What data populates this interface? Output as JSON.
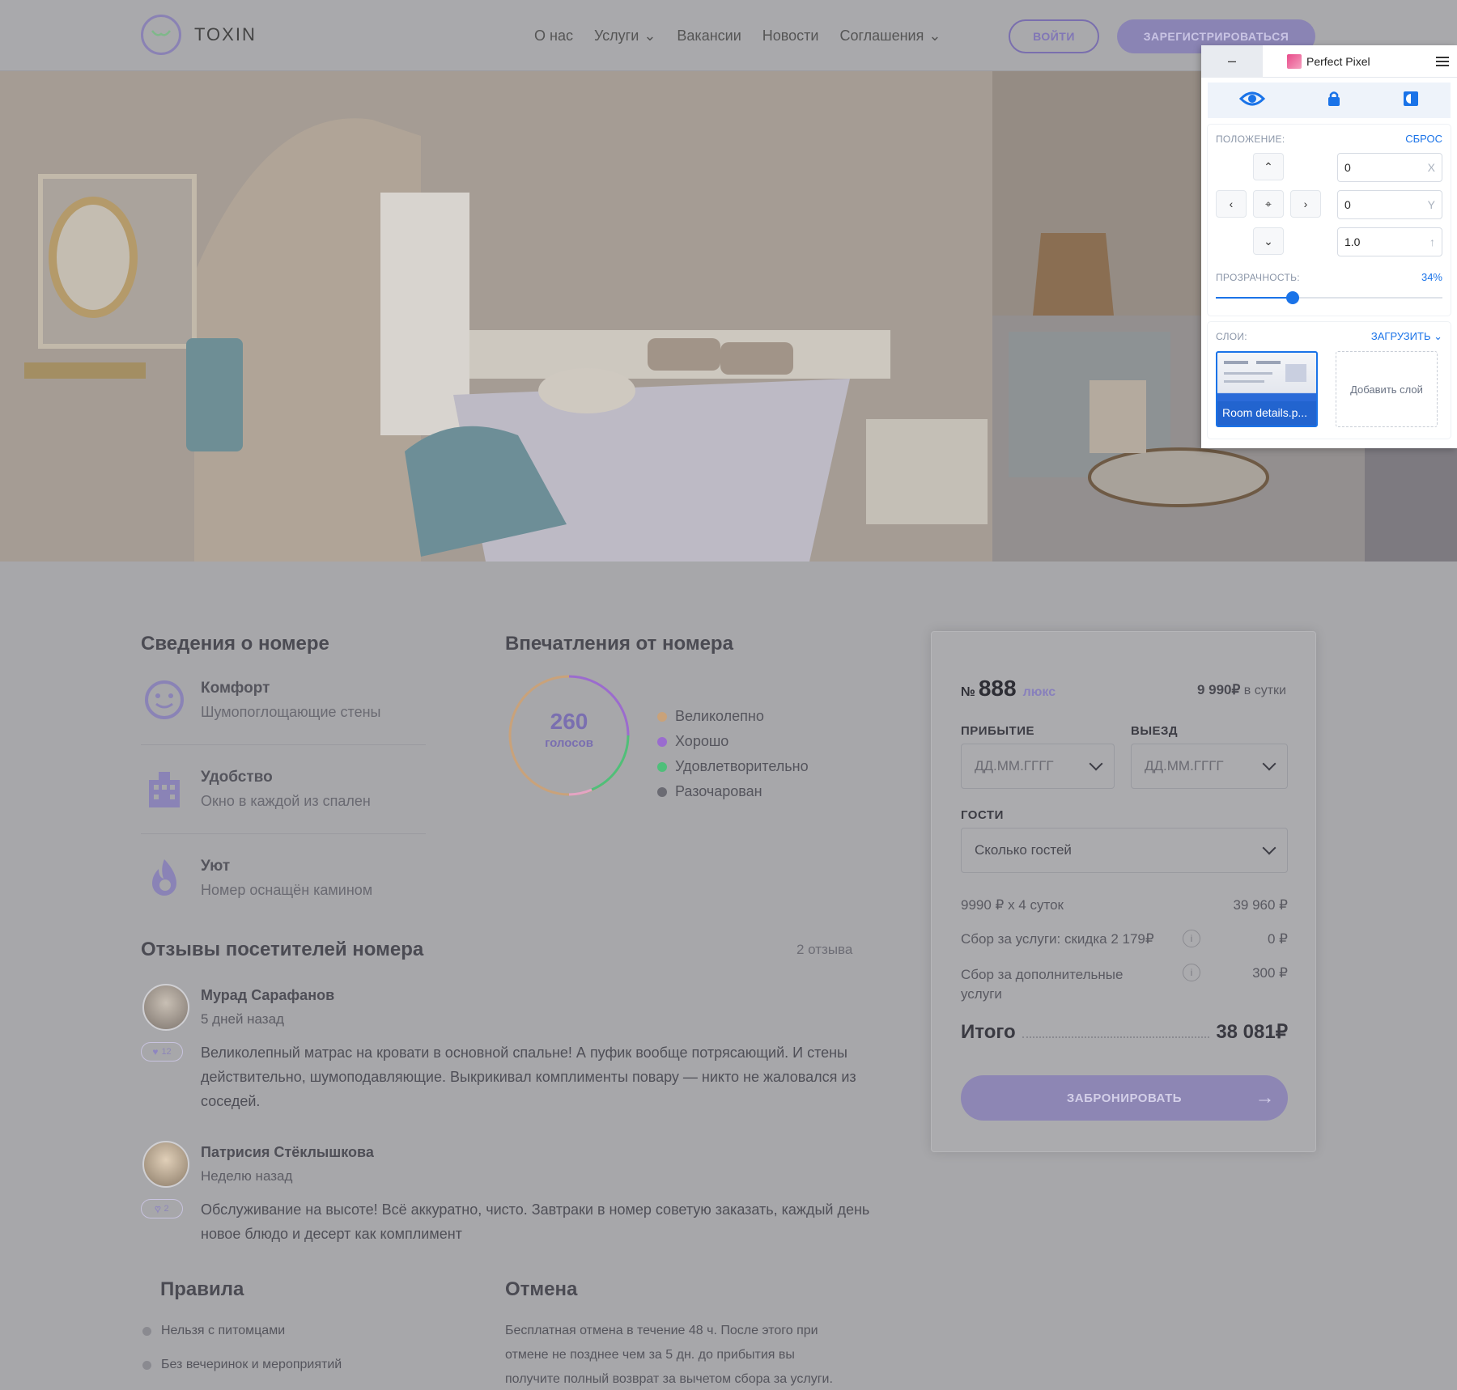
{
  "header": {
    "logo_text": "TOXIN",
    "nav": [
      "О нас",
      "Услуги",
      "Вакансии",
      "Новости",
      "Соглашения"
    ],
    "login_label": "ВОЙТИ",
    "register_label": "ЗАРЕГИСТРИРОВАТЬСЯ"
  },
  "perfect_pixel": {
    "title": "Perfect Pixel",
    "minimize": "–",
    "position_label": "ПОЛОЖЕНИЕ:",
    "reset_label": "СБРОС",
    "x_value": "0",
    "x_suffix": "X",
    "y_value": "0",
    "y_suffix": "Y",
    "scale_value": "1.0",
    "opacity_label": "ПРОЗРАЧНОСТЬ:",
    "opacity_value": "34%",
    "opacity_fraction": 0.34,
    "layers_label": "СЛОИ:",
    "upload_label": "ЗАГРУЗИТЬ",
    "layer_name": "Room details.p...",
    "add_layer_label": "Добавить слой"
  },
  "room_info": {
    "title": "Сведения о номере",
    "features": [
      {
        "title": "Комфорт",
        "desc": "Шумопоглощающие стены"
      },
      {
        "title": "Удобство",
        "desc": "Окно в каждой из спален"
      },
      {
        "title": "Уют",
        "desc": "Номер оснащён камином"
      }
    ]
  },
  "impressions": {
    "title": "Впечатления от номера",
    "votes": "260",
    "votes_label": "голосов",
    "legend": [
      {
        "label": "Великолепно",
        "color": "#c9a27a"
      },
      {
        "label": "Хорошо",
        "color": "#9a6ccf"
      },
      {
        "label": "Удовлетворительно",
        "color": "#4fbf7a"
      },
      {
        "label": "Разочарован",
        "color": "#6b6b73"
      }
    ]
  },
  "reviews": {
    "title": "Отзывы посетителей номера",
    "count": "2 отзыва",
    "items": [
      {
        "name": "Мурад Сарафанов",
        "date": "5 дней назад",
        "likes": "12",
        "text": "Великолепный матрас на кровати в основной спальне! А пуфик вообще потрясающий. И стены действительно, шумоподавляющие. Выкрикивал комплименты повару — никто не жаловался из соседей."
      },
      {
        "name": "Патрисия Стёклышкова",
        "date": "Неделю назад",
        "likes": "2",
        "text": "Обслуживание на высоте! Всё аккуратно, чисто. Завтраки в номер советую заказать, каждый день новое блюдо и десерт как комплимент"
      }
    ]
  },
  "rules": {
    "title": "Правила",
    "items": [
      "Нельзя с питомцами",
      "Без вечеринок и мероприятий"
    ]
  },
  "cancel": {
    "title": "Отмена",
    "text": "Бесплатная отмена в течение 48 ч. После этого при отмене не позднее чем за 5 дн. до прибытия вы получите полный возврат за вычетом сбора за услуги."
  },
  "booking": {
    "room_no": "№",
    "room_number": "888",
    "room_type": "люкс",
    "price": "9 990₽",
    "price_unit": "в сутки",
    "arrival_label": "ПРИБЫТИЕ",
    "arrival_placeholder": "ДД.ММ.ГГГГ",
    "departure_label": "ВЫЕЗД",
    "departure_placeholder": "ДД.ММ.ГГГГ",
    "guests_label": "ГОСТИ",
    "guests_placeholder": "Сколько гостей",
    "line1_label": "9990 ₽ х 4 суток",
    "line1_value": "39 960 ₽",
    "line2_label": "Сбор за услуги: скидка 2 179₽",
    "line2_value": "0 ₽",
    "line3_label": "Сбор за дополнительные услуги",
    "line3_value": "300 ₽",
    "info_icon": "i",
    "total_label": "Итого",
    "total_value": "38 081₽",
    "book_label": "ЗАБРОНИРОВАТЬ"
  }
}
